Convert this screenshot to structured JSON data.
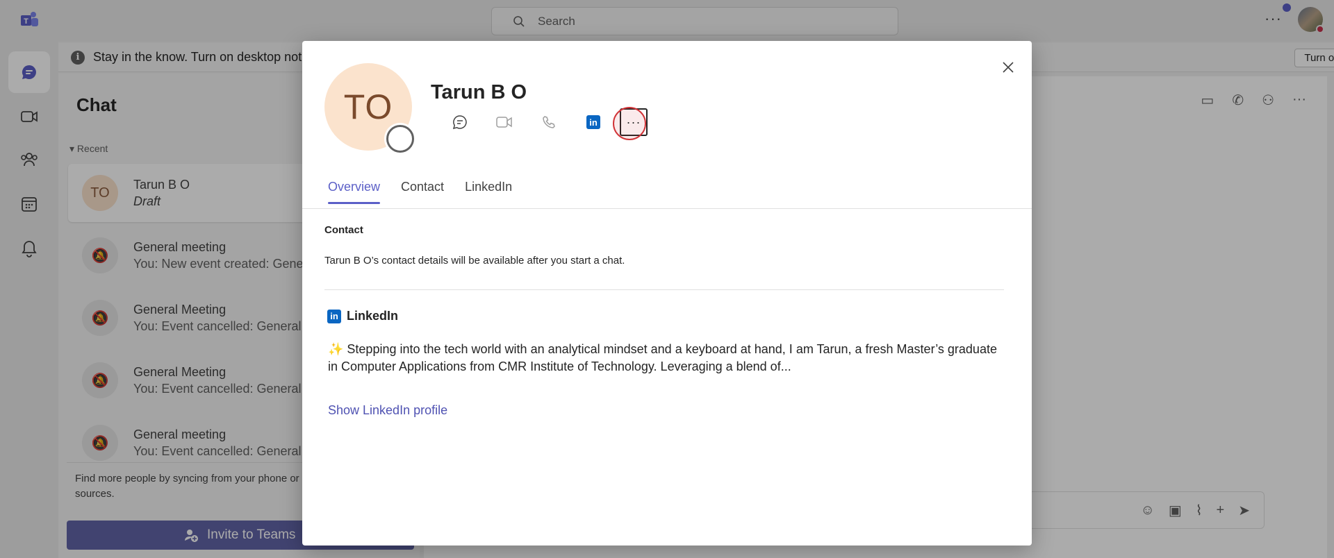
{
  "topbar": {
    "search_placeholder": "Search",
    "more_label": "···"
  },
  "banner": {
    "text": "Stay in the know. Turn on desktop notifications.",
    "turn_on_label": "Turn on",
    "close_label": "✕"
  },
  "chat_list": {
    "title": "Chat",
    "recent_label": "Recent",
    "items": [
      {
        "initials": "TO",
        "name": "Tarun B O",
        "preview": "Draft"
      },
      {
        "name": "General meeting",
        "preview": "You: New event created: General meeting"
      },
      {
        "name": "General Meeting",
        "preview": "You: Event cancelled: General Meeting"
      },
      {
        "name": "General Meeting",
        "preview": "You: Event cancelled: General Meeting"
      },
      {
        "name": "General meeting",
        "preview": "You: Event cancelled: General meeting"
      }
    ],
    "sync_text": "Find more people by syncing from your phone or other sources.",
    "invite_label": "Invite to Teams"
  },
  "profile": {
    "initials": "TO",
    "name": "Tarun B O",
    "more_label": "···",
    "tabs": [
      "Overview",
      "Contact",
      "LinkedIn"
    ],
    "contact_title": "Contact",
    "contact_text": "Tarun B O’s contact details will be available after you start a chat.",
    "linkedin_title": "LinkedIn",
    "linkedin_logo": "in",
    "linkedin_bio": "✨ Stepping into the tech world with an analytical mindset and a keyboard at hand, I am Tarun, a fresh Master’s graduate in Computer Applications from CMR Institute of Technology. Leveraging a blend of...",
    "linkedin_link": "Show LinkedIn profile"
  },
  "colors": {
    "brand": "#5b5fc7",
    "invite": "#6264a7",
    "linkedin": "#0a66c2",
    "avatar_bg": "#fbe3cd",
    "highlight_ring": "#d13438"
  }
}
